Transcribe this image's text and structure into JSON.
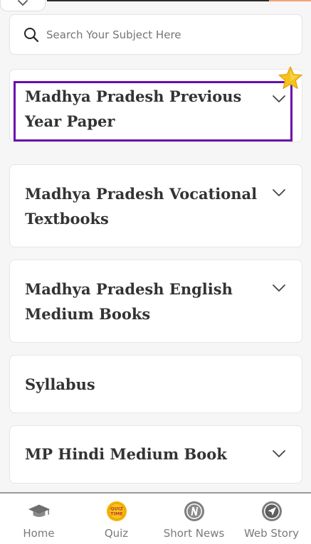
{
  "search": {
    "placeholder": "Search Your Subject Here"
  },
  "cards": [
    {
      "title": "Madhya Pradesh Previous Year Paper",
      "has_chevron": true,
      "highlighted": true
    },
    {
      "title": "Madhya Pradesh Vocational Textbooks",
      "has_chevron": true
    },
    {
      "title": "Madhya Pradesh English Medium Books",
      "has_chevron": true
    },
    {
      "title": "Syllabus",
      "has_chevron": false
    },
    {
      "title": "MP Hindi Medium Book",
      "has_chevron": true
    }
  ],
  "quiz_badge": {
    "line1": "QUIZ",
    "line2": "TIME"
  },
  "bottom_nav": [
    {
      "label": "Home",
      "icon": "graduation-cap-icon"
    },
    {
      "label": "Quiz",
      "icon": "quiz-time-icon"
    },
    {
      "label": "Short News",
      "icon": "news-n-icon"
    },
    {
      "label": "Web Story",
      "icon": "navigation-arrow-icon"
    }
  ],
  "colors": {
    "highlight": "#6a0dad",
    "card_text": "#333333",
    "nav_label": "#7a7a7a",
    "quiz_badge": "#f5b400",
    "star": "#f6c21c"
  }
}
